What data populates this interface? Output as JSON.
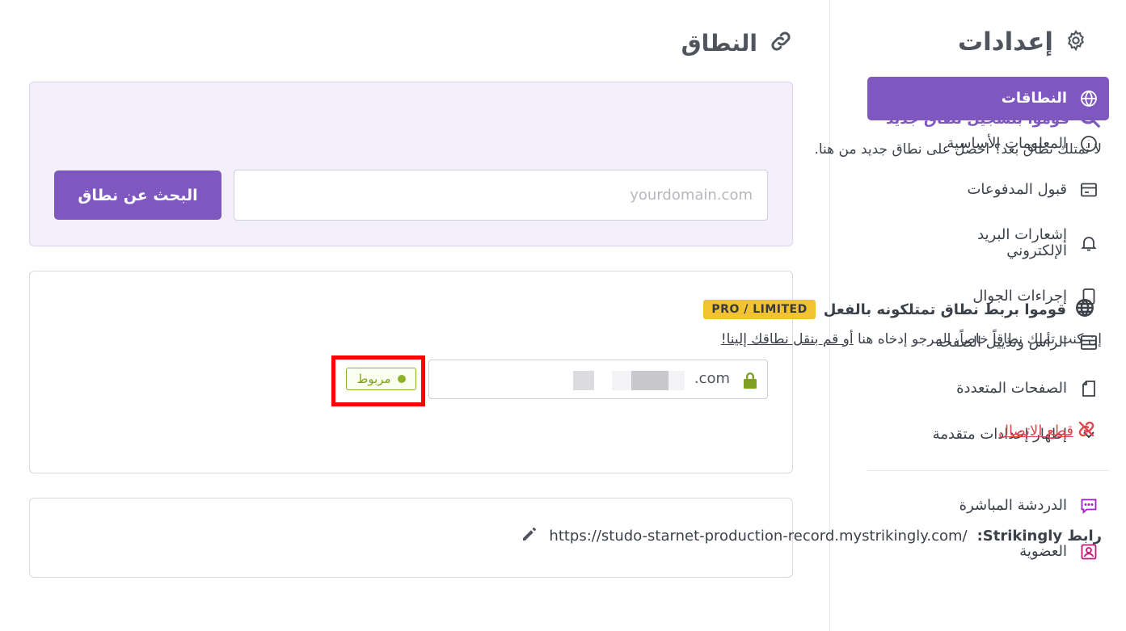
{
  "sidebar": {
    "title": "إعدادات",
    "title_icon": "gear-icon",
    "items": [
      {
        "label": "النطاقات",
        "icon": "globe-icon",
        "active": true
      },
      {
        "label": "المعلومات الأساسية",
        "icon": "info-icon"
      },
      {
        "label": "قبول المدفوعات",
        "icon": "payment-card-icon"
      },
      {
        "label": "إشعارات البريد الإلكتروني",
        "icon": "bell-icon"
      },
      {
        "label": "إجراءات الجوال",
        "icon": "mobile-icon"
      },
      {
        "label": "الرأس وتذييل الصفحة",
        "icon": "layout-icon"
      },
      {
        "label": "الصفحات المتعددة",
        "icon": "pages-icon"
      },
      {
        "label": "إظهار إعدادات متقدمة",
        "icon": "chevron-down-icon"
      }
    ],
    "extras": [
      {
        "label": "الدردشة المباشرة",
        "icon": "chat-icon"
      },
      {
        "label": "العضوية",
        "icon": "membership-icon"
      }
    ]
  },
  "main": {
    "title": "النطاق",
    "title_icon": "link-icon",
    "register": {
      "heading": "قوموا بتسجيل نطاق جديد",
      "subtitle": "لا تمتلك نطاق بعد؟ احصل على نطاق جديد من هنا.",
      "input_placeholder": "yourdomain.com",
      "button_label": "البحث عن نطاق"
    },
    "connect": {
      "heading": "قوموا بربط نطاق تمتلكونه بالفعل",
      "badge": "PRO / LIMITED",
      "subtitle_prefix": "إن كنت تملك نطاقاً خاصاً، المرجو إدخاه هنا",
      "subtitle_link": "أو قم بنقل نطاقك إلينا!",
      "domain_value": ".com",
      "status": "مربوط",
      "disconnect_label": "قطع الاتصال"
    },
    "strikingly_link": {
      "label": "رابط Strikingly:",
      "url": "https://studo-starnet-production-record.mystrikingly.com/"
    }
  },
  "colors": {
    "accent": "#7e58bf",
    "status_green": "#8bb22a",
    "danger": "#e1464f",
    "pro_badge": "#f1c232",
    "highlight_frame": "#ff0000"
  }
}
